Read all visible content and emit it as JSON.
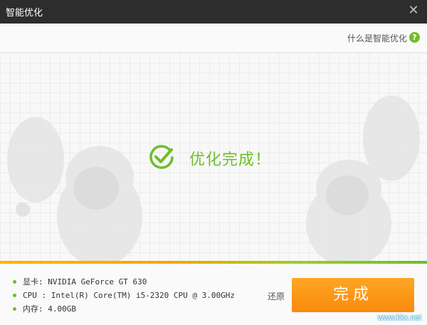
{
  "window": {
    "title": "智能优化",
    "close_icon": "close-icon"
  },
  "topbar": {
    "help_link": "什么是智能优化",
    "help_icon": "?"
  },
  "result": {
    "icon": "check-circle-icon",
    "text": "优化完成！"
  },
  "footer": {
    "info": [
      "显卡: NVIDIA GeForce GT 630",
      "CPU : Intel(R) Core(TM) i5-2320 CPU @ 3.00GHz",
      "内存: 4.00GB"
    ],
    "restore_label": "还原",
    "done_label": "完成"
  },
  "watermark": {
    "text": "www.kkx.net"
  },
  "colors": {
    "accent_green": "#6fbd2c",
    "button_orange": "#f98a0e",
    "titlebar": "#2d2d2d"
  }
}
